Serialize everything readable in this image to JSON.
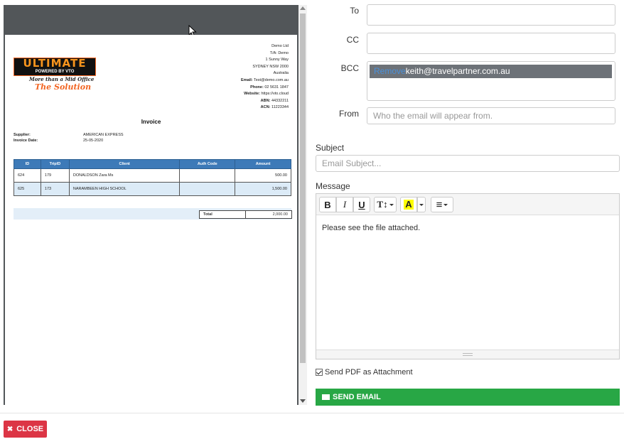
{
  "invoice": {
    "logo": {
      "main": "ULTIMATE",
      "sub": "POWERED BY VTO",
      "tag1": "More than a Mid Office",
      "tag2": "The Solution"
    },
    "company": {
      "name": "Demo Ltd",
      "trading_as": "T/A: Demo",
      "street": "1 Sunny Way",
      "city": "SYDNEY NSW 2000",
      "country": "Australia",
      "email_label": "Email:",
      "email": "Test@demo.com.au",
      "phone_label": "Phone:",
      "phone": "02 5631 1847",
      "website_label": "Website:",
      "website": "https://vto.cloud",
      "abn_label": "ABN:",
      "abn": "44332211",
      "acn_label": "ACN:",
      "acn": "11223344"
    },
    "title": "Invoice",
    "supplier_label": "Supplier:",
    "supplier": "AMERICAN EXPRESS",
    "date_label": "Invoice Date:",
    "date": "25-05-2020",
    "columns": [
      "ID",
      "TripID",
      "Client",
      "Auth Code",
      "Amount"
    ],
    "rows": [
      {
        "id": "624",
        "trip": "179",
        "client": "DONALDSON Zara Ms",
        "auth": "",
        "amount": "500.00"
      },
      {
        "id": "625",
        "trip": "173",
        "client": "NARAMBEEN HIGH SCHOOL",
        "auth": "",
        "amount": "1,500.00"
      }
    ],
    "total_label": "Total",
    "total": "2,000.00"
  },
  "email": {
    "to_label": "To",
    "to_value": "",
    "cc_label": "CC",
    "cc_value": "",
    "bcc_label": "BCC",
    "bcc_prefix": "Remove",
    "bcc_address": "keith@travelpartner.com.au",
    "from_label": "From",
    "from_placeholder": "Who the email will appear from.",
    "subject_label": "Subject",
    "subject_placeholder": "Email Subject...",
    "message_label": "Message",
    "message_body": "Please see the file attached.",
    "toolbar": {
      "bold": "B",
      "italic": "I",
      "underline": "U",
      "font_size": "T↕",
      "color": "A",
      "align": "≡"
    },
    "attach_label": "Send PDF as Attachment",
    "attach_checked": true,
    "send_label": "SEND EMAIL"
  },
  "footer": {
    "close_label": "CLOSE"
  },
  "colors": {
    "send": "#28a745",
    "close": "#dc3545",
    "table_header": "#3d7ab8",
    "highlight": "#ffff00"
  }
}
